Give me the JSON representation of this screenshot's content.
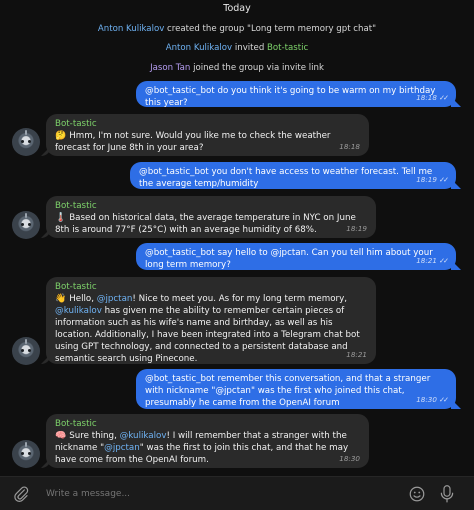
{
  "date_header": "Today",
  "system_messages": [
    {
      "name": "Anton Kulikalov",
      "text": " created the group \"Long term memory gpt chat\""
    },
    {
      "name": "Anton Kulikalov",
      "text": " invited ",
      "target": "Bot-tastic"
    },
    {
      "name": "Jason Tan",
      "text": " joined the group via invite link"
    }
  ],
  "messages": [
    {
      "text": "@bot_tastic_bot do you think it's going to be warm on my birthday this year?",
      "time": "18:18",
      "status": "read"
    },
    {
      "sender": "Bot-tastic",
      "emoji": "🤔",
      "text": "Hmm, I'm not sure. Would you like me to check the weather forecast for June 8th in your area?",
      "time": "18:18"
    },
    {
      "text": "@bot_tastic_bot you don't have access to weather forecast. Tell me the average temp/humidity",
      "time": "18:19",
      "status": "read"
    },
    {
      "sender": "Bot-tastic",
      "emoji": "🌡️",
      "text": "Based on historical data, the average temperature in NYC on June 8th is around 77°F (25°C) with an average humidity of 68%.",
      "time": "18:19"
    },
    {
      "text": "@bot_tastic_bot say hello to @jpctan. Can you tell him about your long term memory?",
      "time": "18:21",
      "status": "read"
    },
    {
      "sender": "Bot-tastic",
      "emoji": "👋",
      "part1": "Hello, ",
      "mention1": "@jpctan",
      "part2": "! Nice to meet you. As for my long term memory, ",
      "mention2": "@kulikalov",
      "part3": " has given me the ability to remember certain pieces of information such as his wife's name and birthday, as well as his location. Additionally, I have been integrated into a Telegram chat bot using GPT technology, and connected to a persistent database and semantic search using Pinecone.",
      "time": "18:21"
    },
    {
      "text": "@bot_tastic_bot remember this conversation, and that a stranger with nickname \"@jpctan\" was the first who joined this chat, presumably he came from the OpenAI forum",
      "time": "18:30",
      "status": "read"
    },
    {
      "sender": "Bot-tastic",
      "emoji": "🧠",
      "part1": "Sure thing, ",
      "mention1": "@kulikalov",
      "part2": "! I will remember that a stranger with the nickname \"",
      "mention2": "@jpctan",
      "part3": "\" was the first to join this chat, and that he may have come from the OpenAI forum.",
      "time": "18:30"
    }
  ],
  "composer": {
    "placeholder": "Write a message..."
  },
  "colors": {
    "outgoing": "#2e6ee6",
    "incoming": "#2a2a2a",
    "bot_name": "#7ed36b",
    "mention": "#6fb2f3"
  },
  "icons": {
    "attach": "paperclip-icon",
    "emoji": "smiley-icon",
    "voice": "microphone-icon"
  }
}
